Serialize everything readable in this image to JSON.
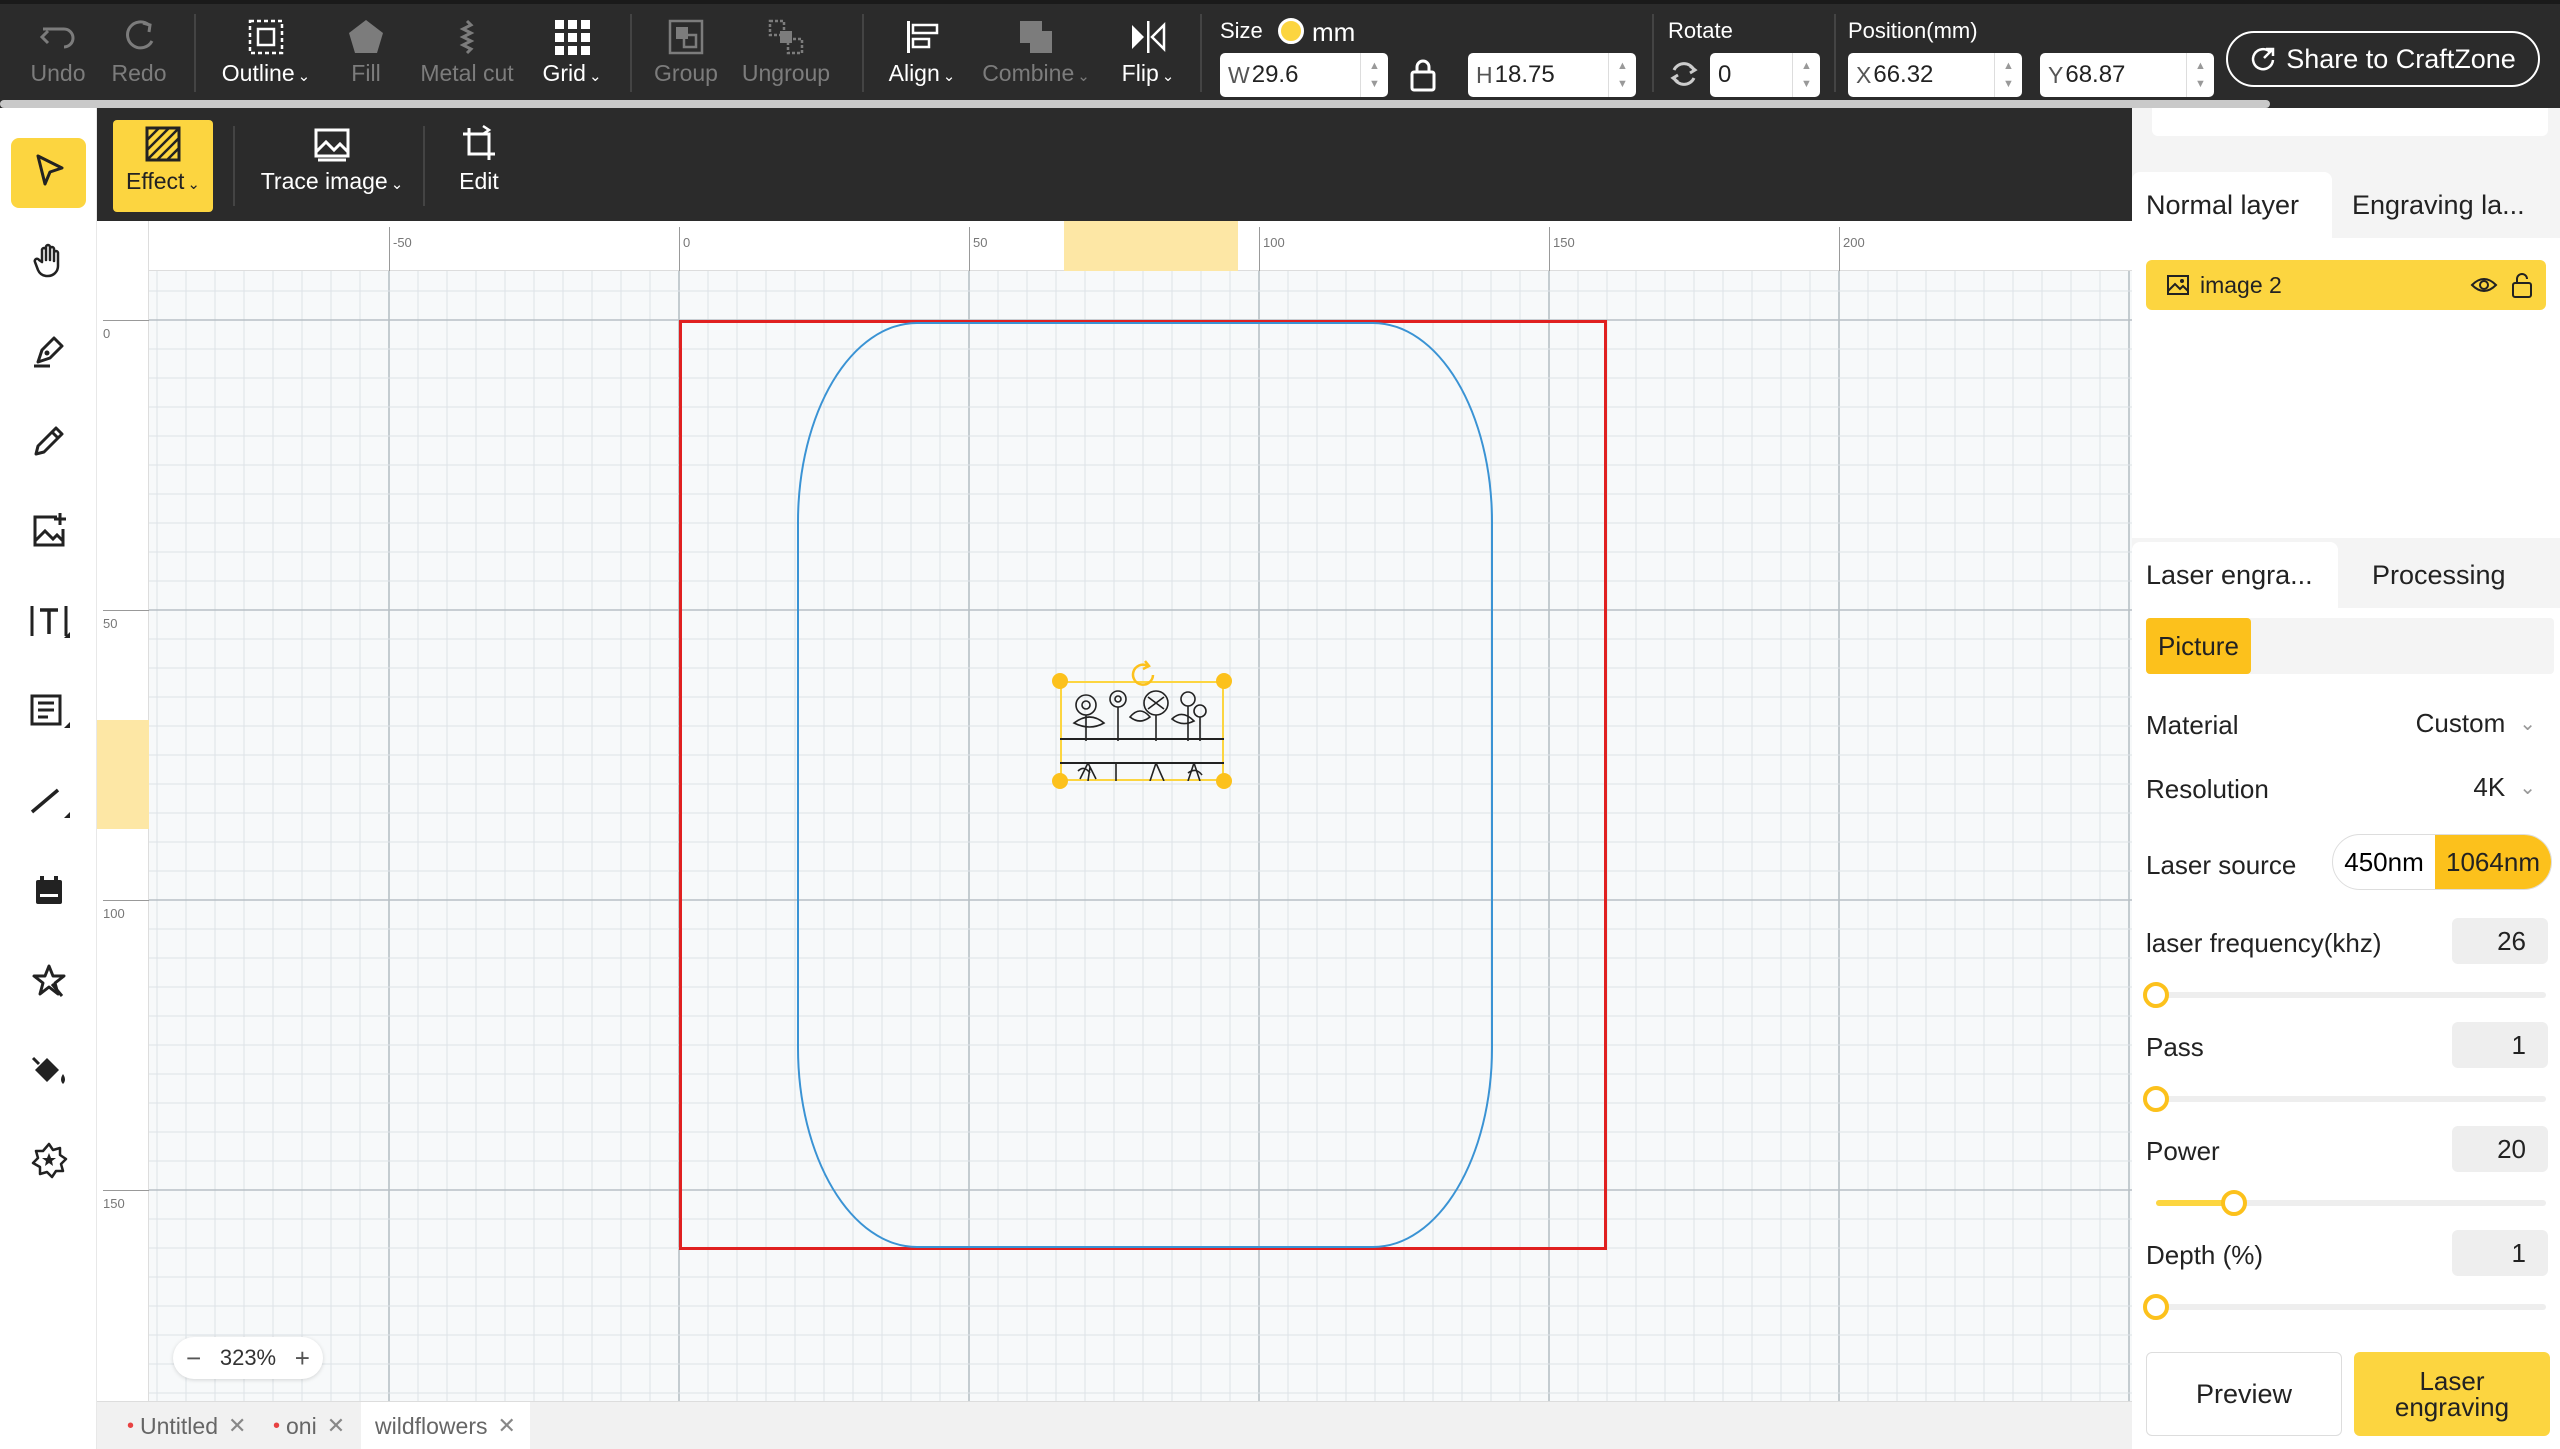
{
  "toolbar": {
    "undo": "Undo",
    "redo": "Redo",
    "outline": "Outline",
    "fill": "Fill",
    "metal_cut": "Metal cut",
    "grid": "Grid",
    "group": "Group",
    "ungroup": "Ungroup",
    "align": "Align",
    "combine": "Combine",
    "flip": "Flip",
    "size_label": "Size",
    "unit": "mm",
    "width_prefix": "W",
    "width_value": "29.6",
    "height_prefix": "H",
    "height_value": "18.75",
    "rotate_label": "Rotate",
    "rotate_value": "0",
    "position_label": "Position(mm)",
    "x_prefix": "X",
    "x_value": "66.32",
    "y_prefix": "Y",
    "y_value": "68.87",
    "share_label": "Share to CraftZone"
  },
  "subbar": {
    "effect": "Effect",
    "trace_image": "Trace image",
    "edit": "Edit"
  },
  "rulers": {
    "top": [
      "-50",
      "0",
      "50",
      "100",
      "150",
      "200"
    ],
    "left": [
      "0",
      "50",
      "100",
      "150"
    ]
  },
  "canvas": {
    "zoom": "323%"
  },
  "doc_tabs": [
    {
      "label": "Untitled",
      "unsaved": true
    },
    {
      "label": "oni",
      "unsaved": true
    },
    {
      "label": "wildflowers",
      "unsaved": false
    }
  ],
  "layers": {
    "tab_normal": "Normal layer",
    "tab_engraving": "Engraving la...",
    "items": [
      {
        "name": "image 2"
      }
    ]
  },
  "settings": {
    "tab_laser": "Laser engra...",
    "tab_processing": "Processing",
    "mode": "Picture",
    "material_label": "Material",
    "material_value": "Custom",
    "resolution_label": "Resolution",
    "resolution_value": "4K",
    "laser_source_label": "Laser source",
    "laser_source_options": [
      "450nm",
      "1064nm"
    ],
    "laser_source_selected": "1064nm",
    "frequency_label": "laser frequency(khz)",
    "frequency_value": "26",
    "frequency_fraction": 0,
    "pass_label": "Pass",
    "pass_value": "1",
    "pass_fraction": 0,
    "power_label": "Power",
    "power_value": "20",
    "power_fraction": 0.2,
    "depth_label": "Depth (%)",
    "depth_value": "1",
    "depth_fraction": 0,
    "preview_label": "Preview",
    "laser_button_label": "Laser engraving"
  },
  "colors": {
    "accent": "#fcd540",
    "toolbar_bg": "#2b2b2b",
    "work_area": "#e02020",
    "object_outline": "#3a93d4"
  }
}
